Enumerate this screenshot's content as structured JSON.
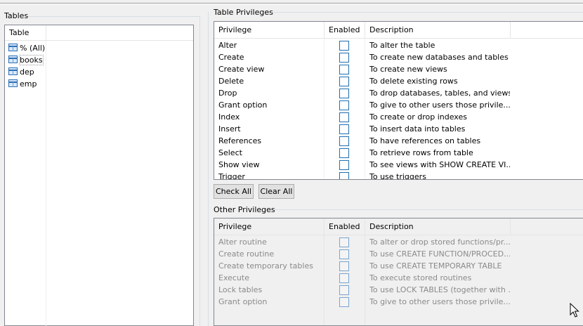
{
  "tables_panel": {
    "title": "Tables",
    "column_header": "Table",
    "items": [
      {
        "label": "% (All)",
        "icon": "table-icon"
      },
      {
        "label": "books",
        "icon": "table-icon",
        "selected": true
      },
      {
        "label": "dep",
        "icon": "table-icon"
      },
      {
        "label": "emp",
        "icon": "table-icon"
      }
    ]
  },
  "table_privileges": {
    "title": "Table Privileges",
    "headers": {
      "privilege": "Privilege",
      "enabled": "Enabled",
      "description": "Description"
    },
    "rows": [
      {
        "privilege": "Alter",
        "enabled": false,
        "description": "To alter the table"
      },
      {
        "privilege": "Create",
        "enabled": false,
        "description": "To create new databases and tables"
      },
      {
        "privilege": "Create view",
        "enabled": false,
        "description": "To create new views"
      },
      {
        "privilege": "Delete",
        "enabled": false,
        "description": "To delete existing rows"
      },
      {
        "privilege": "Drop",
        "enabled": false,
        "description": "To drop databases, tables, and views"
      },
      {
        "privilege": "Grant option",
        "enabled": false,
        "description": "To give to other users those privile..."
      },
      {
        "privilege": "Index",
        "enabled": false,
        "description": "To create or drop indexes"
      },
      {
        "privilege": "Insert",
        "enabled": false,
        "description": "To insert data into tables"
      },
      {
        "privilege": "References",
        "enabled": false,
        "description": "To have references on tables"
      },
      {
        "privilege": "Select",
        "enabled": false,
        "description": "To retrieve rows from table"
      },
      {
        "privilege": "Show view",
        "enabled": false,
        "description": "To see views with SHOW CREATE VI..."
      },
      {
        "privilege": "Trigger",
        "enabled": false,
        "description": "To use triggers"
      }
    ],
    "check_all_label": "Check All",
    "clear_all_label": "Clear All"
  },
  "other_privileges": {
    "title": "Other Privileges",
    "headers": {
      "privilege": "Privilege",
      "enabled": "Enabled",
      "description": "Description"
    },
    "rows": [
      {
        "privilege": "Alter routine",
        "enabled": false,
        "description": "To alter or drop stored functions/pr..."
      },
      {
        "privilege": "Create routine",
        "enabled": false,
        "description": "To use CREATE FUNCTION/PROCED..."
      },
      {
        "privilege": "Create temporary tables",
        "enabled": false,
        "description": "To use CREATE TEMPORARY TABLE"
      },
      {
        "privilege": "Execute",
        "enabled": false,
        "description": "To execute stored routines"
      },
      {
        "privilege": "Lock tables",
        "enabled": false,
        "description": "To use LOCK TABLES (together with ..."
      },
      {
        "privilege": "Grant option",
        "enabled": false,
        "description": "To give to other users those privile..."
      }
    ]
  },
  "colors": {
    "window_bg": "#f0f0f0",
    "grid_border": "#828790",
    "checkbox_border": "#1f6fb2",
    "disabled_text": "#8a8a8a"
  }
}
